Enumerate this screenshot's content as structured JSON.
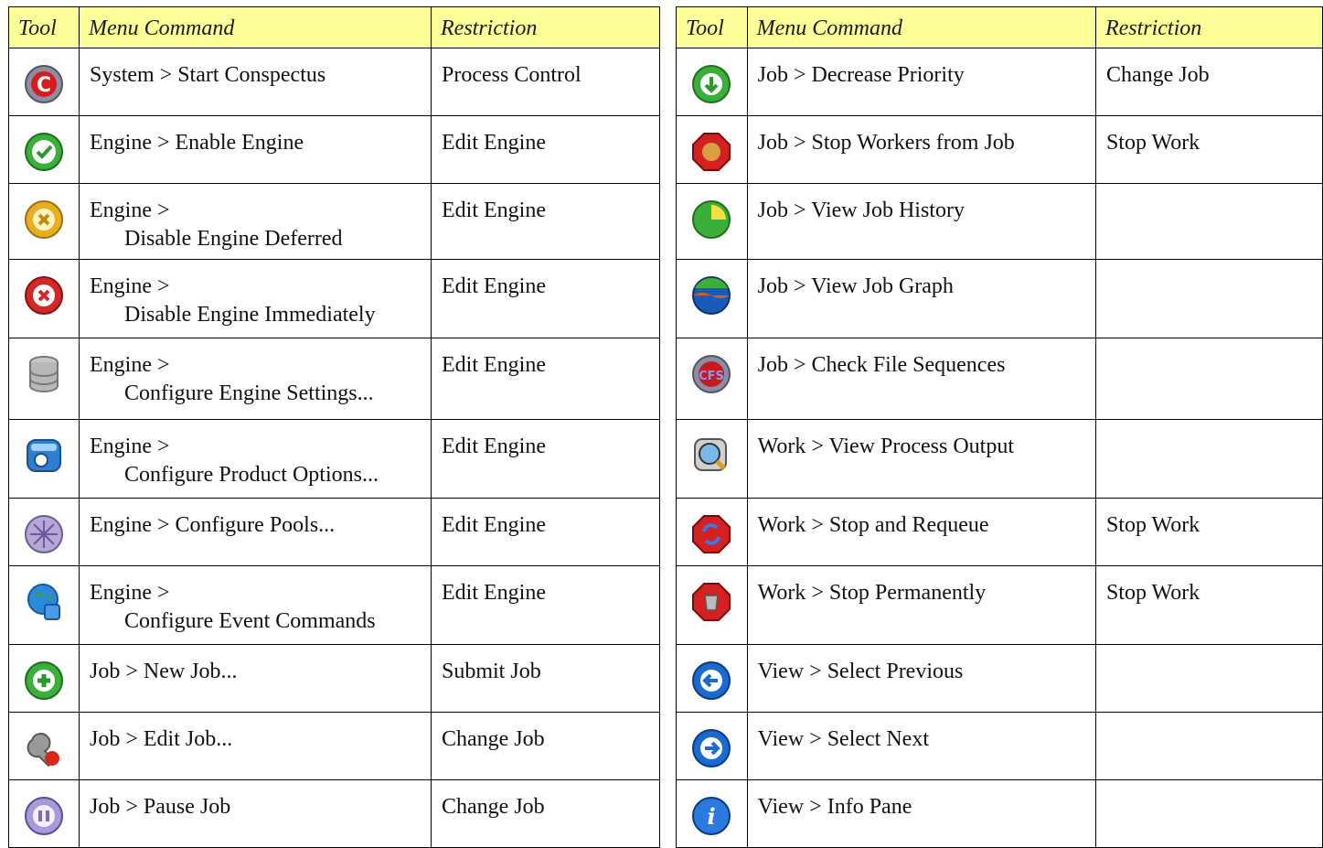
{
  "headers": {
    "tool": "Tool",
    "menu_command": "Menu Command",
    "restriction": "Restriction"
  },
  "left": [
    {
      "icon": "start-conspectus-icon",
      "cmd": [
        "System > Start Conspectus"
      ],
      "restriction": "Process Control"
    },
    {
      "icon": "enable-engine-icon",
      "cmd": [
        "Engine > Enable Engine"
      ],
      "restriction": "Edit Engine"
    },
    {
      "icon": "disable-deferred-icon",
      "cmd": [
        "Engine >",
        "Disable Engine Deferred"
      ],
      "restriction": "Edit Engine"
    },
    {
      "icon": "disable-immediately-icon",
      "cmd": [
        "Engine >",
        "Disable Engine Immediately"
      ],
      "restriction": "Edit Engine"
    },
    {
      "icon": "database-icon",
      "cmd": [
        "Engine >",
        "Configure Engine Settings..."
      ],
      "restriction": "Edit Engine"
    },
    {
      "icon": "product-options-icon",
      "cmd": [
        "Engine >",
        "Configure Product Options..."
      ],
      "restriction": "Edit Engine"
    },
    {
      "icon": "pools-icon",
      "cmd": [
        "Engine > Configure Pools..."
      ],
      "restriction": "Edit Engine"
    },
    {
      "icon": "event-commands-icon",
      "cmd": [
        "Engine >",
        "Configure Event Commands"
      ],
      "restriction": "Edit Engine"
    },
    {
      "icon": "new-job-icon",
      "cmd": [
        "Job > New Job..."
      ],
      "restriction": "Submit Job"
    },
    {
      "icon": "edit-job-icon",
      "cmd": [
        "Job > Edit Job..."
      ],
      "restriction": "Change Job"
    },
    {
      "icon": "pause-job-icon",
      "cmd": [
        "Job > Pause Job"
      ],
      "restriction": "Change Job"
    }
  ],
  "right": [
    {
      "icon": "decrease-priority-icon",
      "cmd": [
        "Job > Decrease Priority"
      ],
      "restriction": "Change Job"
    },
    {
      "icon": "stop-workers-icon",
      "cmd": [
        "Job > Stop Workers from Job"
      ],
      "restriction": "Stop Work"
    },
    {
      "icon": "job-history-icon",
      "cmd": [
        "Job > View Job History"
      ],
      "restriction": ""
    },
    {
      "icon": "job-graph-icon",
      "cmd": [
        "Job > View Job Graph"
      ],
      "restriction": ""
    },
    {
      "icon": "file-sequences-icon",
      "cmd": [
        "Job > Check File Sequences"
      ],
      "restriction": ""
    },
    {
      "icon": "process-output-icon",
      "cmd": [
        "Work > View Process Output"
      ],
      "restriction": ""
    },
    {
      "icon": "stop-requeue-icon",
      "cmd": [
        "Work > Stop and Requeue"
      ],
      "restriction": "Stop Work"
    },
    {
      "icon": "stop-permanently-icon",
      "cmd": [
        "Work > Stop Permanently"
      ],
      "restriction": "Stop Work"
    },
    {
      "icon": "select-previous-icon",
      "cmd": [
        "View > Select Previous"
      ],
      "restriction": ""
    },
    {
      "icon": "select-next-icon",
      "cmd": [
        "View > Select Next"
      ],
      "restriction": ""
    },
    {
      "icon": "info-pane-icon",
      "cmd": [
        "View > Info Pane"
      ],
      "restriction": ""
    }
  ]
}
